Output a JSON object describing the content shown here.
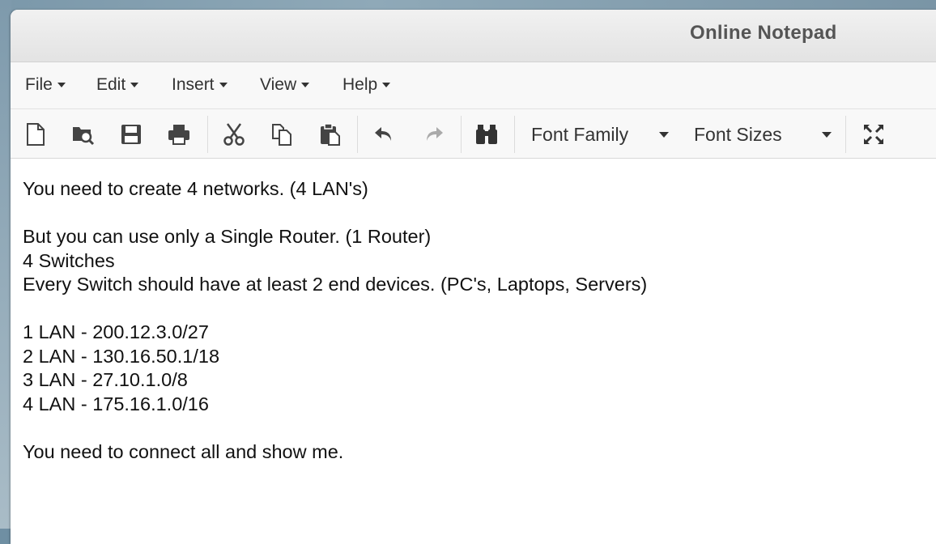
{
  "window": {
    "title": "Online Notepad"
  },
  "menu": {
    "items": [
      {
        "label": "File"
      },
      {
        "label": "Edit"
      },
      {
        "label": "Insert"
      },
      {
        "label": "View"
      },
      {
        "label": "Help"
      }
    ]
  },
  "toolbar": {
    "buttons": [
      {
        "icon": "new-file-icon"
      },
      {
        "icon": "open-file-icon"
      },
      {
        "icon": "save-icon"
      },
      {
        "icon": "print-icon"
      },
      {
        "icon": "cut-icon"
      },
      {
        "icon": "copy-icon"
      },
      {
        "icon": "paste-icon"
      },
      {
        "icon": "undo-icon"
      },
      {
        "icon": "redo-icon"
      },
      {
        "icon": "find-icon"
      },
      {
        "icon": "fullscreen-icon"
      }
    ],
    "font_family_label": "Font Family",
    "font_sizes_label": "Font Sizes"
  },
  "editor": {
    "lines": [
      "You need to create 4 networks. (4 LAN's)",
      "But you can use only a Single Router. (1 Router)",
      "4 Switches",
      "Every Switch should have at least 2 end devices. (PC's, Laptops, Servers)",
      "1 LAN - 200.12.3.0/27",
      "2 LAN - 130.16.50.1/18",
      "3 LAN - 27.10.1.0/8",
      "4 LAN - 175.16.1.0/16",
      "You need to connect all and show me."
    ]
  }
}
